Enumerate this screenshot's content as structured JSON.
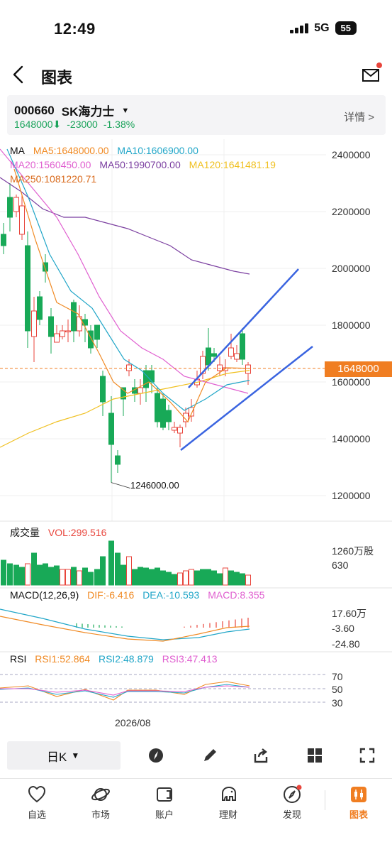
{
  "status": {
    "time": "12:49",
    "network": "5G",
    "battery": "55"
  },
  "nav": {
    "title": "图表"
  },
  "stock": {
    "code": "000660",
    "name": "SK海力士",
    "price": "1648000",
    "arrow": "⬇",
    "change": "-23000",
    "change_pct": "-1.38%",
    "detail_label": "详情 >"
  },
  "ma_legend": {
    "ma": "MA",
    "ma5": "MA5:1648000.00",
    "ma10": "MA10:1606900.00",
    "ma20": "MA20:1560450.00",
    "ma50": "MA50:1990700.00",
    "ma120": "MA120:1641481.19",
    "ma250": "MA250:1081220.71"
  },
  "colors": {
    "up": "#e8453c",
    "down": "#18a957",
    "ma5": "#f08a24",
    "ma10": "#21a6c8",
    "ma20": "#e060d0",
    "ma50": "#7b3fa0",
    "ma120": "#f0c020",
    "ma250": "#d96a1c",
    "trendline": "#3a64e0"
  },
  "price_axis": [
    "2400000",
    "2200000",
    "2000000",
    "1800000",
    "1600000",
    "1400000",
    "1200000"
  ],
  "current_price_tag": "1648000",
  "low_marker": "1246000.00",
  "volume": {
    "label": "成交量",
    "vol": "VOL:299.516",
    "axis": [
      "1260万股",
      "630"
    ]
  },
  "macd": {
    "label": "MACD(12,26,9)",
    "dif": "DIF:-6.416",
    "dea": "DEA:-10.593",
    "macd": "MACD:8.355",
    "axis": [
      "17.60万",
      "-3.60",
      "-24.80"
    ]
  },
  "rsi": {
    "label": "RSI",
    "rsi1": "RSI1:52.864",
    "rsi2": "RSI2:48.879",
    "rsi3": "RSI3:47.413",
    "axis": [
      "70",
      "50",
      "30"
    ]
  },
  "date_label": "2026/08",
  "toolbar": {
    "period": "日K"
  },
  "tabs": [
    {
      "label": "自选",
      "icon": "heart-icon"
    },
    {
      "label": "市场",
      "icon": "planet-icon"
    },
    {
      "label": "账户",
      "icon": "wallet-icon"
    },
    {
      "label": "理财",
      "icon": "elephant-icon"
    },
    {
      "label": "发现",
      "icon": "compass-icon"
    },
    {
      "label": "图表",
      "icon": "candlestick-icon"
    }
  ]
}
